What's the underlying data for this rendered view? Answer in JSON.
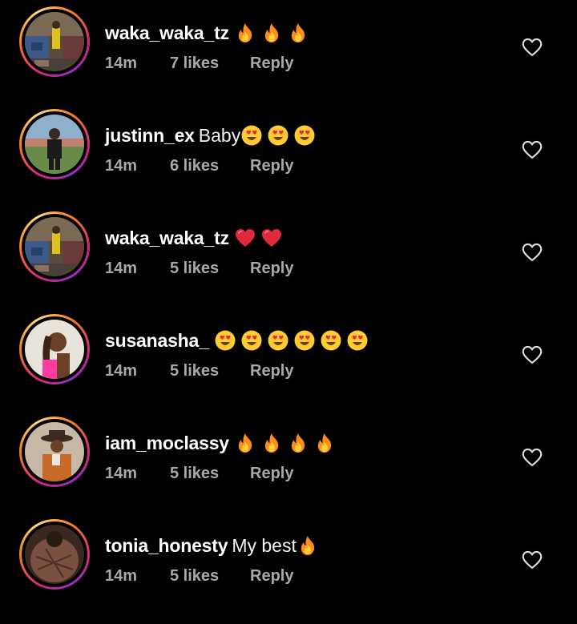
{
  "comments": [
    {
      "username": "waka_waka_tz",
      "text": "",
      "emojis": [
        "fire",
        "fire",
        "fire"
      ],
      "time": "14m",
      "likes": "7 likes",
      "reply": "Reply",
      "avatar": "market-scene",
      "like_icon": "heart-outline-icon"
    },
    {
      "username": "justinn_ex",
      "text": "Baby",
      "emojis": [
        "heart-eyes",
        "heart-eyes",
        "heart-eyes"
      ],
      "time": "14m",
      "likes": "6 likes",
      "reply": "Reply",
      "avatar": "man-outdoors",
      "like_icon": "heart-outline-icon"
    },
    {
      "username": "waka_waka_tz",
      "text": "",
      "emojis": [
        "red-heart",
        "red-heart"
      ],
      "time": "14m",
      "likes": "5 likes",
      "reply": "Reply",
      "avatar": "market-scene",
      "like_icon": "heart-outline-icon"
    },
    {
      "username": "susanasha_",
      "text": "",
      "emojis": [
        "heart-eyes",
        "heart-eyes",
        "heart-eyes",
        "heart-eyes",
        "heart-eyes",
        "heart-eyes"
      ],
      "time": "14m",
      "likes": "5 likes",
      "reply": "Reply",
      "avatar": "woman-braids",
      "like_icon": "heart-outline-icon"
    },
    {
      "username": "iam_moclassy",
      "text": "",
      "emojis": [
        "fire",
        "fire",
        "fire",
        "fire"
      ],
      "time": "14m",
      "likes": "5 likes",
      "reply": "Reply",
      "avatar": "man-hat",
      "like_icon": "heart-outline-icon"
    },
    {
      "username": "tonia_honesty",
      "text": "My best",
      "emojis": [
        "fire"
      ],
      "time": "14m",
      "likes": "5 likes",
      "reply": "Reply",
      "avatar": "portrait-closeup",
      "like_icon": "heart-outline-icon"
    }
  ],
  "colors": {
    "background": "#000000",
    "text_primary": "#ffffff",
    "text_secondary": "#a8a8a8",
    "story_ring": [
      "#d62976",
      "#fa7e1e",
      "#feda75",
      "#962fbf"
    ]
  }
}
